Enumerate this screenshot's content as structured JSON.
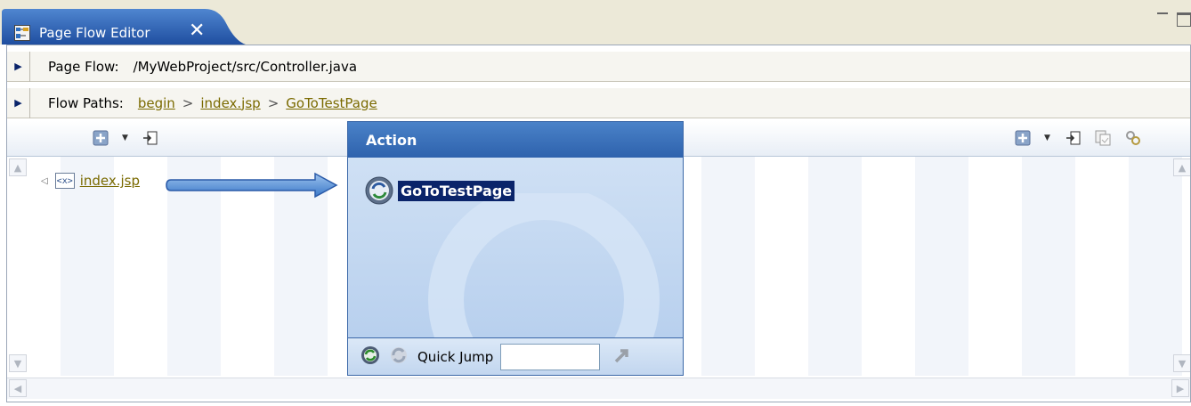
{
  "tab": {
    "title": "Page Flow Editor",
    "close": "✕"
  },
  "page_flow": {
    "label": "Page Flow:",
    "value": "/MyWebProject/src/Controller.java"
  },
  "flow_paths": {
    "label": "Flow Paths:",
    "crumbs": [
      "begin",
      "index.jsp",
      "GoToTestPage"
    ],
    "separator": ">"
  },
  "left_node": {
    "icon_text": "<x>",
    "label": "index.jsp"
  },
  "action_panel": {
    "header": "Action",
    "selected_action": "GoToTestPage",
    "quick_jump_label": "Quick Jump",
    "quick_jump_value": ""
  },
  "icons": {
    "tab": "page-flow-editor-icon",
    "left_toolbar": [
      "new-node-icon",
      "dropdown-caret-icon",
      "jump-icon"
    ],
    "right_toolbar": [
      "new-node-icon",
      "dropdown-caret-icon",
      "jump-icon",
      "copy-icon",
      "link-icon"
    ],
    "action": "action-icon",
    "footer": [
      "refresh-action-icon",
      "disabled-action-icon",
      "go-arrow-icon"
    ]
  },
  "colors": {
    "tab_bg": "#2f5fb3",
    "action_header": "#2e62ad",
    "selection": "#0a246a",
    "link": "#7a6a00"
  }
}
